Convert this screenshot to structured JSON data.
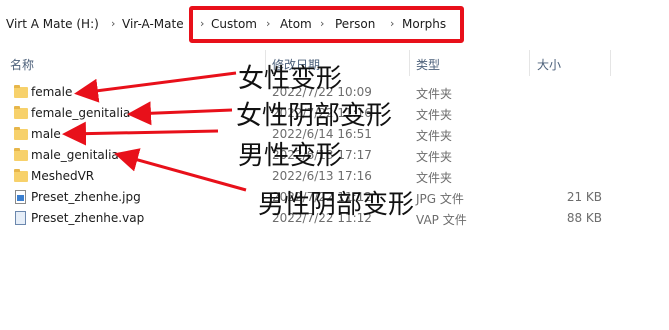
{
  "address_bar": {
    "crumbs": [
      "Virt A Mate (H:)",
      "Vir-A-Mate",
      "Custom",
      "Atom",
      "Person",
      "Morphs"
    ],
    "separator": "›"
  },
  "columns": {
    "name": "名称",
    "date": "修改日期",
    "type": "类型",
    "size": "大小"
  },
  "files": [
    {
      "name": "female",
      "date": "2022/7/22 10:09",
      "type": "文件夹",
      "size": "",
      "icon": "folder-icon"
    },
    {
      "name": "female_genitalia",
      "date": "2022/7/22 11:16",
      "type": "文件夹",
      "size": "",
      "icon": "folder-icon"
    },
    {
      "name": "male",
      "date": "2022/6/14 16:51",
      "type": "文件夹",
      "size": "",
      "icon": "folder-icon"
    },
    {
      "name": "male_genitalia",
      "date": "2022/6/13 17:17",
      "type": "文件夹",
      "size": "",
      "icon": "folder-icon"
    },
    {
      "name": "MeshedVR",
      "date": "2022/6/13 17:16",
      "type": "文件夹",
      "size": "",
      "icon": "folder-icon"
    },
    {
      "name": "Preset_zhenhe.jpg",
      "date": "2022/7/22 11:12",
      "type": "JPG 文件",
      "size": "21 KB",
      "icon": "image-file-icon"
    },
    {
      "name": "Preset_zhenhe.vap",
      "date": "2022/7/22 11:12",
      "type": "VAP 文件",
      "size": "88 KB",
      "icon": "vap-file-icon"
    }
  ],
  "annotations": {
    "female": "女性变形",
    "female_genitalia": "女性阴部变形",
    "male": "男性变形",
    "male_genitalia": "男性阴部变形"
  },
  "colors": {
    "highlight": "#e8101a",
    "folder": "#f7d16b",
    "header_text": "#4c607a"
  }
}
